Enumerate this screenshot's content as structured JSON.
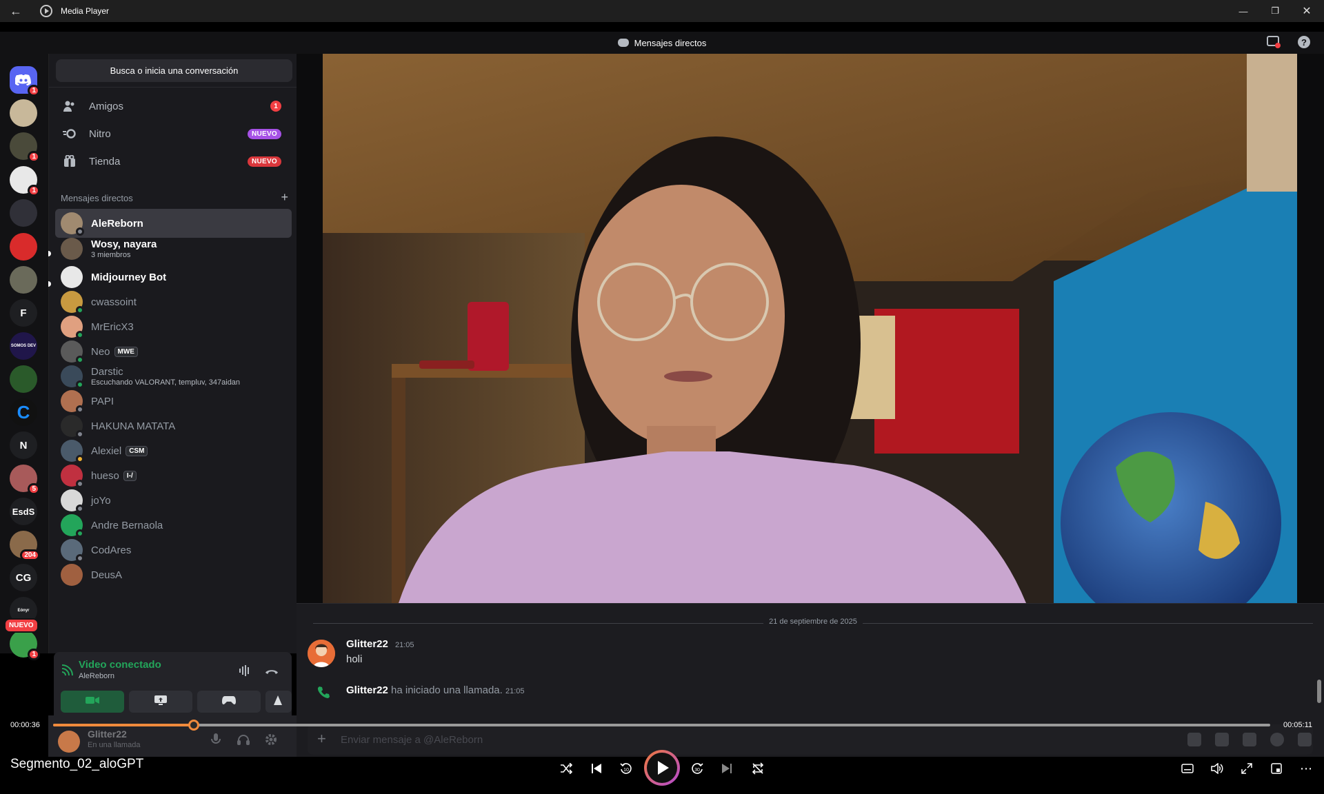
{
  "window": {
    "title": "Media Player"
  },
  "discord": {
    "header_title": "Mensajes directos",
    "search_placeholder": "Busca o inicia una conversación",
    "nav": [
      {
        "label": "Amigos",
        "icon": "friends-icon",
        "count": "1"
      },
      {
        "label": "Nitro",
        "icon": "nitro-icon",
        "pill": "NUEVO",
        "pill_color": "#a651e6"
      },
      {
        "label": "Tienda",
        "icon": "shop-icon",
        "pill": "NUEVO",
        "pill_color": "#da373c"
      }
    ],
    "dm_section_label": "Mensajes directos",
    "servers": [
      {
        "name": "discord-home",
        "badge": "1",
        "text": ""
      },
      {
        "name": "server-2",
        "badge": "",
        "text": ""
      },
      {
        "name": "server-3",
        "badge": "1",
        "text": ""
      },
      {
        "name": "server-4",
        "badge": "1",
        "text": ""
      },
      {
        "name": "server-5",
        "badge": "",
        "text": ""
      },
      {
        "name": "server-6",
        "badge": "",
        "text": ""
      },
      {
        "name": "server-7",
        "badge": "",
        "text": ""
      },
      {
        "name": "server-f",
        "badge": "",
        "text": "F"
      },
      {
        "name": "server-somos-dev",
        "badge": "",
        "text": "SOMOS DEV"
      },
      {
        "name": "server-10",
        "badge": "",
        "text": ""
      },
      {
        "name": "server-c",
        "badge": "",
        "text": "C"
      },
      {
        "name": "server-n",
        "badge": "",
        "text": "N"
      },
      {
        "name": "server-13",
        "badge": "5",
        "text": ""
      },
      {
        "name": "server-esds",
        "badge": "",
        "text": "EsdS"
      },
      {
        "name": "server-15",
        "badge": "204",
        "text": ""
      },
      {
        "name": "server-cg",
        "badge": "",
        "text": "CG"
      },
      {
        "name": "server-eonyr",
        "badge": "",
        "text": "Eónyr"
      },
      {
        "name": "server-18",
        "badge": "1",
        "text": ""
      }
    ],
    "new_server_pill": "NUEVO",
    "dms": [
      {
        "name": "AleReborn",
        "sub": "",
        "tag": "",
        "status": "offline",
        "active": true,
        "bright": true
      },
      {
        "name": "Wosy, nayara",
        "sub": "3 miembros",
        "tag": "",
        "status": "",
        "active": false,
        "bright": true
      },
      {
        "name": "Midjourney Bot",
        "sub": "",
        "tag": "",
        "status": "",
        "active": false,
        "bright": true
      },
      {
        "name": "cwassoint",
        "sub": "",
        "tag": "",
        "status": "online",
        "active": false,
        "bright": false
      },
      {
        "name": "MrEricX3",
        "sub": "",
        "tag": "",
        "status": "online",
        "active": false,
        "bright": false
      },
      {
        "name": "Neo",
        "sub": "",
        "tag": "MWE",
        "status": "online",
        "active": false,
        "bright": false
      },
      {
        "name": "Darstic",
        "sub": "Escuchando VALORANT, templuv, 347aidan",
        "tag": "",
        "status": "online",
        "active": false,
        "bright": false
      },
      {
        "name": "PAPI",
        "sub": "",
        "tag": "",
        "status": "offline",
        "active": false,
        "bright": false
      },
      {
        "name": "HAKUNA MATATA",
        "sub": "",
        "tag": "",
        "status": "offline",
        "active": false,
        "bright": false
      },
      {
        "name": "Alexiel",
        "sub": "",
        "tag": "CSM",
        "status": "idle",
        "active": false,
        "bright": false
      },
      {
        "name": "hueso",
        "sub": "",
        "tag": "I-/",
        "status": "offline",
        "active": false,
        "bright": false
      },
      {
        "name": "joYo",
        "sub": "",
        "tag": "",
        "status": "offline",
        "active": false,
        "bright": false
      },
      {
        "name": "Andre Bernaola",
        "sub": "",
        "tag": "",
        "status": "online",
        "active": false,
        "bright": false
      },
      {
        "name": "CodAres",
        "sub": "",
        "tag": "",
        "status": "offline",
        "active": false,
        "bright": false
      },
      {
        "name": "DeusA",
        "sub": "",
        "tag": "",
        "status": "",
        "active": false,
        "bright": false
      }
    ],
    "voice": {
      "title": "Video conectado",
      "channel": "AleReborn"
    },
    "user": {
      "name": "Glitter22",
      "status": "En una llamada"
    },
    "chat": {
      "date": "21 de septiembre de 2025",
      "author": "Glitter22",
      "time": "21:05",
      "text": "holi",
      "call_author": "Glitter22",
      "call_text": "ha iniciado una llamada.",
      "call_time": "21:05",
      "input_placeholder": "Enviar mensaje a @AleReborn"
    }
  },
  "player": {
    "title": "Segmento_02_aloGPT",
    "current_time": "00:00:36",
    "duration": "00:05:11",
    "progress": 0.1158
  },
  "colors": {
    "accent": "#f08a3c",
    "online": "#23a55a",
    "danger": "#f23f43"
  }
}
